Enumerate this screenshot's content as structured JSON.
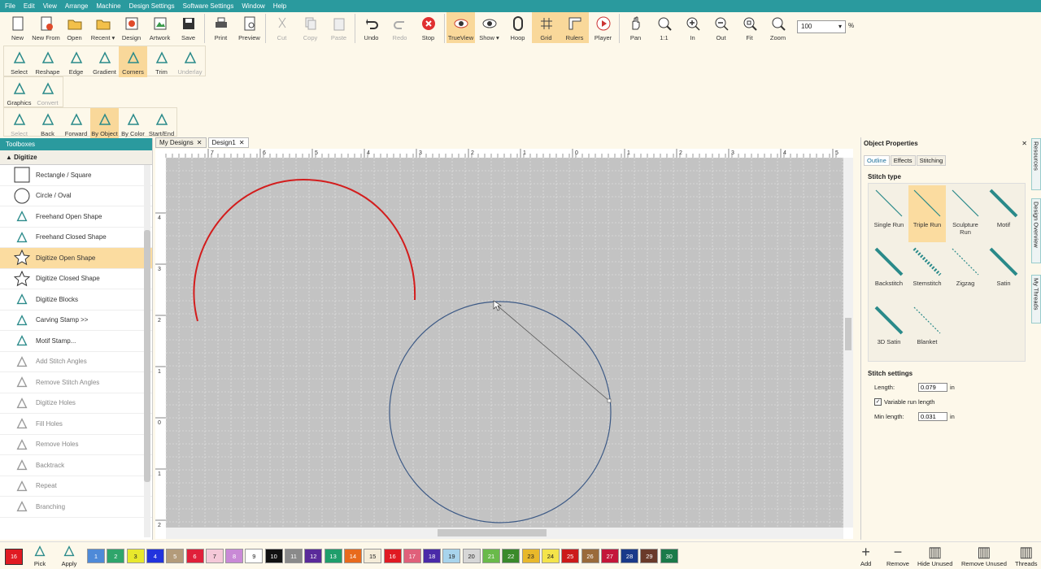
{
  "menu": [
    "File",
    "Edit",
    "View",
    "Arrange",
    "Machine",
    "Design Settings",
    "Software Settings",
    "Window",
    "Help"
  ],
  "toolbar": {
    "buttons": [
      {
        "label": "New",
        "icon": "new-document-icon",
        "state": ""
      },
      {
        "label": "New From",
        "icon": "new-from-icon",
        "state": ""
      },
      {
        "label": "Open",
        "icon": "folder-open-icon",
        "state": ""
      },
      {
        "label": "Recent ▾",
        "icon": "recent-folder-icon",
        "state": ""
      },
      {
        "label": "Design",
        "icon": "design-icon",
        "state": ""
      },
      {
        "label": "Artwork",
        "icon": "artwork-icon",
        "state": ""
      },
      {
        "label": "Save",
        "icon": "save-icon",
        "state": ""
      },
      {
        "label": "Print",
        "icon": "print-icon",
        "state": ""
      },
      {
        "label": "Preview",
        "icon": "preview-icon",
        "state": ""
      },
      {
        "label": "Cut",
        "icon": "cut-icon",
        "state": "disabled"
      },
      {
        "label": "Copy",
        "icon": "copy-icon",
        "state": "disabled"
      },
      {
        "label": "Paste",
        "icon": "paste-icon",
        "state": "disabled"
      },
      {
        "label": "Undo",
        "icon": "undo-icon",
        "state": ""
      },
      {
        "label": "Redo",
        "icon": "redo-icon",
        "state": "disabled"
      },
      {
        "label": "Stop",
        "icon": "stop-icon",
        "state": ""
      },
      {
        "label": "TrueView",
        "icon": "trueview-icon",
        "state": "active"
      },
      {
        "label": "Show ▾",
        "icon": "eye-icon",
        "state": ""
      },
      {
        "label": "Hoop",
        "icon": "hoop-icon",
        "state": ""
      },
      {
        "label": "Grid",
        "icon": "grid-icon",
        "state": "active"
      },
      {
        "label": "Rulers",
        "icon": "rulers-icon",
        "state": "active"
      },
      {
        "label": "Player",
        "icon": "play-icon",
        "state": ""
      },
      {
        "label": "Pan",
        "icon": "hand-icon",
        "state": ""
      },
      {
        "label": "1:1",
        "icon": "zoom-1to1-icon",
        "state": ""
      },
      {
        "label": "In",
        "icon": "zoom-in-icon",
        "state": ""
      },
      {
        "label": "Out",
        "icon": "zoom-out-icon",
        "state": ""
      },
      {
        "label": "Fit",
        "icon": "zoom-fit-icon",
        "state": ""
      },
      {
        "label": "Zoom",
        "icon": "zoom-icon",
        "state": ""
      }
    ],
    "zoom_value": "100",
    "zoom_unit": "%"
  },
  "row2": [
    {
      "label": "Select",
      "icon": "select-arrow-icon",
      "state": ""
    },
    {
      "label": "Reshape",
      "icon": "reshape-icon",
      "state": ""
    },
    {
      "label": "Edge",
      "icon": "edge-icon",
      "state": ""
    },
    {
      "label": "Gradient",
      "icon": "gradient-icon",
      "state": ""
    },
    {
      "label": "Corners",
      "icon": "corners-icon",
      "state": "active"
    },
    {
      "label": "Trim",
      "icon": "trim-icon",
      "state": ""
    },
    {
      "label": "Underlay",
      "icon": "underlay-icon",
      "state": "disabled"
    }
  ],
  "row3": [
    {
      "label": "Graphics",
      "icon": "graphics-icon",
      "state": ""
    },
    {
      "label": "Convert",
      "icon": "convert-icon",
      "state": "disabled"
    }
  ],
  "row4": [
    {
      "label": "Select",
      "icon": "select-sequence-icon",
      "state": "disabled"
    },
    {
      "label": "Back",
      "icon": "back-arrow-icon",
      "state": ""
    },
    {
      "label": "Forward",
      "icon": "forward-arrow-icon",
      "state": ""
    },
    {
      "label": "By Object",
      "icon": "by-object-icon",
      "state": "active"
    },
    {
      "label": "By Color",
      "icon": "by-color-icon",
      "state": ""
    },
    {
      "label": "Start/End",
      "icon": "start-end-icon",
      "state": ""
    }
  ],
  "toolbox": {
    "title": "Toolboxes",
    "section": "Digitize",
    "tools": [
      {
        "label": "Rectangle / Square",
        "icon": "rectangle-icon",
        "state": ""
      },
      {
        "label": "Circle / Oval",
        "icon": "circle-icon",
        "state": ""
      },
      {
        "label": "Freehand Open Shape",
        "icon": "freehand-open-icon",
        "state": ""
      },
      {
        "label": "Freehand Closed Shape",
        "icon": "freehand-closed-icon",
        "state": ""
      },
      {
        "label": "Digitize Open Shape",
        "icon": "star-open-icon",
        "state": "selected"
      },
      {
        "label": "Digitize Closed Shape",
        "icon": "star-closed-icon",
        "state": ""
      },
      {
        "label": "Digitize Blocks",
        "icon": "blocks-icon",
        "state": ""
      },
      {
        "label": "Carving Stamp >>",
        "icon": "stamp-icon",
        "state": ""
      },
      {
        "label": "Motif Stamp...",
        "icon": "motif-stamp-icon",
        "state": ""
      },
      {
        "label": "Add Stitch Angles",
        "icon": "add-angles-icon",
        "state": "disabled"
      },
      {
        "label": "Remove Stitch Angles",
        "icon": "remove-angles-icon",
        "state": "disabled"
      },
      {
        "label": "Digitize Holes",
        "icon": "digitize-holes-icon",
        "state": "disabled"
      },
      {
        "label": "Fill Holes",
        "icon": "fill-holes-icon",
        "state": "disabled"
      },
      {
        "label": "Remove Holes",
        "icon": "remove-holes-icon",
        "state": "disabled"
      },
      {
        "label": "Backtrack",
        "icon": "backtrack-icon",
        "state": "disabled"
      },
      {
        "label": "Repeat",
        "icon": "repeat-icon",
        "state": "disabled"
      },
      {
        "label": "Branching",
        "icon": "branching-icon",
        "state": "disabled"
      }
    ]
  },
  "doc_tabs": [
    {
      "label": "My Designs",
      "close": "✕",
      "active": false
    },
    {
      "label": "Design1",
      "close": "✕",
      "active": true
    }
  ],
  "ruler": {
    "top_labels": [
      "7",
      "6",
      "5",
      "4",
      "3",
      "2",
      "1",
      "0",
      "1",
      "2",
      "3",
      "4",
      "5"
    ],
    "left_labels": [
      "4",
      "3",
      "2",
      "1",
      "0",
      "1",
      "2"
    ]
  },
  "colors": {
    "accent": "#2a9a9e",
    "selected": "#fbdca0",
    "arc": "#d31c1c",
    "circle": "#3d5a86",
    "canvas": "#c3c3c3"
  },
  "palette": {
    "current": "16",
    "pick_label": "Pick",
    "apply_label": "Apply",
    "swatches": [
      {
        "n": "1",
        "c": "#4e8ad8"
      },
      {
        "n": "2",
        "c": "#2fa56b"
      },
      {
        "n": "3",
        "c": "#e8e82c"
      },
      {
        "n": "4",
        "c": "#2233dd"
      },
      {
        "n": "5",
        "c": "#b39b7a"
      },
      {
        "n": "6",
        "c": "#e0203a"
      },
      {
        "n": "7",
        "c": "#f5c8d8"
      },
      {
        "n": "8",
        "c": "#c989d6"
      },
      {
        "n": "9",
        "c": "#ffffff"
      },
      {
        "n": "10",
        "c": "#111111"
      },
      {
        "n": "11",
        "c": "#8a8a8a"
      },
      {
        "n": "12",
        "c": "#5a2a9a"
      },
      {
        "n": "13",
        "c": "#1f9e6b"
      },
      {
        "n": "14",
        "c": "#e86a1c"
      },
      {
        "n": "15",
        "c": "#f5ecd8"
      },
      {
        "n": "16",
        "c": "#e01a22"
      },
      {
        "n": "17",
        "c": "#e0607a"
      },
      {
        "n": "18",
        "c": "#4a2aa8"
      },
      {
        "n": "19",
        "c": "#a8d4ec"
      },
      {
        "n": "20",
        "c": "#d6d6d6"
      },
      {
        "n": "21",
        "c": "#6aba4a"
      },
      {
        "n": "22",
        "c": "#3a8a2a"
      },
      {
        "n": "23",
        "c": "#e8b82a"
      },
      {
        "n": "24",
        "c": "#f4e44a"
      },
      {
        "n": "25",
        "c": "#cc1a1a"
      },
      {
        "n": "26",
        "c": "#9a6a3a"
      },
      {
        "n": "27",
        "c": "#c4163a"
      },
      {
        "n": "28",
        "c": "#1a3a8a"
      },
      {
        "n": "29",
        "c": "#6a3a2a"
      },
      {
        "n": "30",
        "c": "#1a7a4a"
      }
    ],
    "actions": [
      {
        "label": "Add",
        "icon": "plus-icon"
      },
      {
        "label": "Remove",
        "icon": "minus-icon"
      },
      {
        "label": "Hide Unused",
        "icon": "hide-unused-icon"
      },
      {
        "label": "Remove Unused",
        "icon": "remove-unused-icon"
      },
      {
        "label": "Threads",
        "icon": "threads-icon"
      }
    ]
  },
  "properties": {
    "title": "Object Properties",
    "close": "✕",
    "tabs": [
      "Outline",
      "Effects",
      "Stitching"
    ],
    "stitch_type_label": "Stitch type",
    "stitch_types": [
      {
        "label": "Single Run",
        "selected": false
      },
      {
        "label": "Triple Run",
        "selected": true
      },
      {
        "label": "Sculpture Run",
        "selected": false
      },
      {
        "label": "Motif",
        "selected": false
      },
      {
        "label": "Backstitch",
        "selected": false
      },
      {
        "label": "Stemstitch",
        "selected": false
      },
      {
        "label": "Zigzag",
        "selected": false
      },
      {
        "label": "Satin",
        "selected": false
      },
      {
        "label": "3D Satin",
        "selected": false
      },
      {
        "label": "Blanket",
        "selected": false
      }
    ],
    "stitch_settings_label": "Stitch settings",
    "length_label": "Length:",
    "length_value": "0.079",
    "unit": "in",
    "variable_label": "Variable run length",
    "variable_checked": true,
    "min_length_label": "Min length:",
    "min_length_value": "0.031"
  },
  "side_tabs": [
    "Resources",
    "Design Overview",
    "My Threads"
  ]
}
